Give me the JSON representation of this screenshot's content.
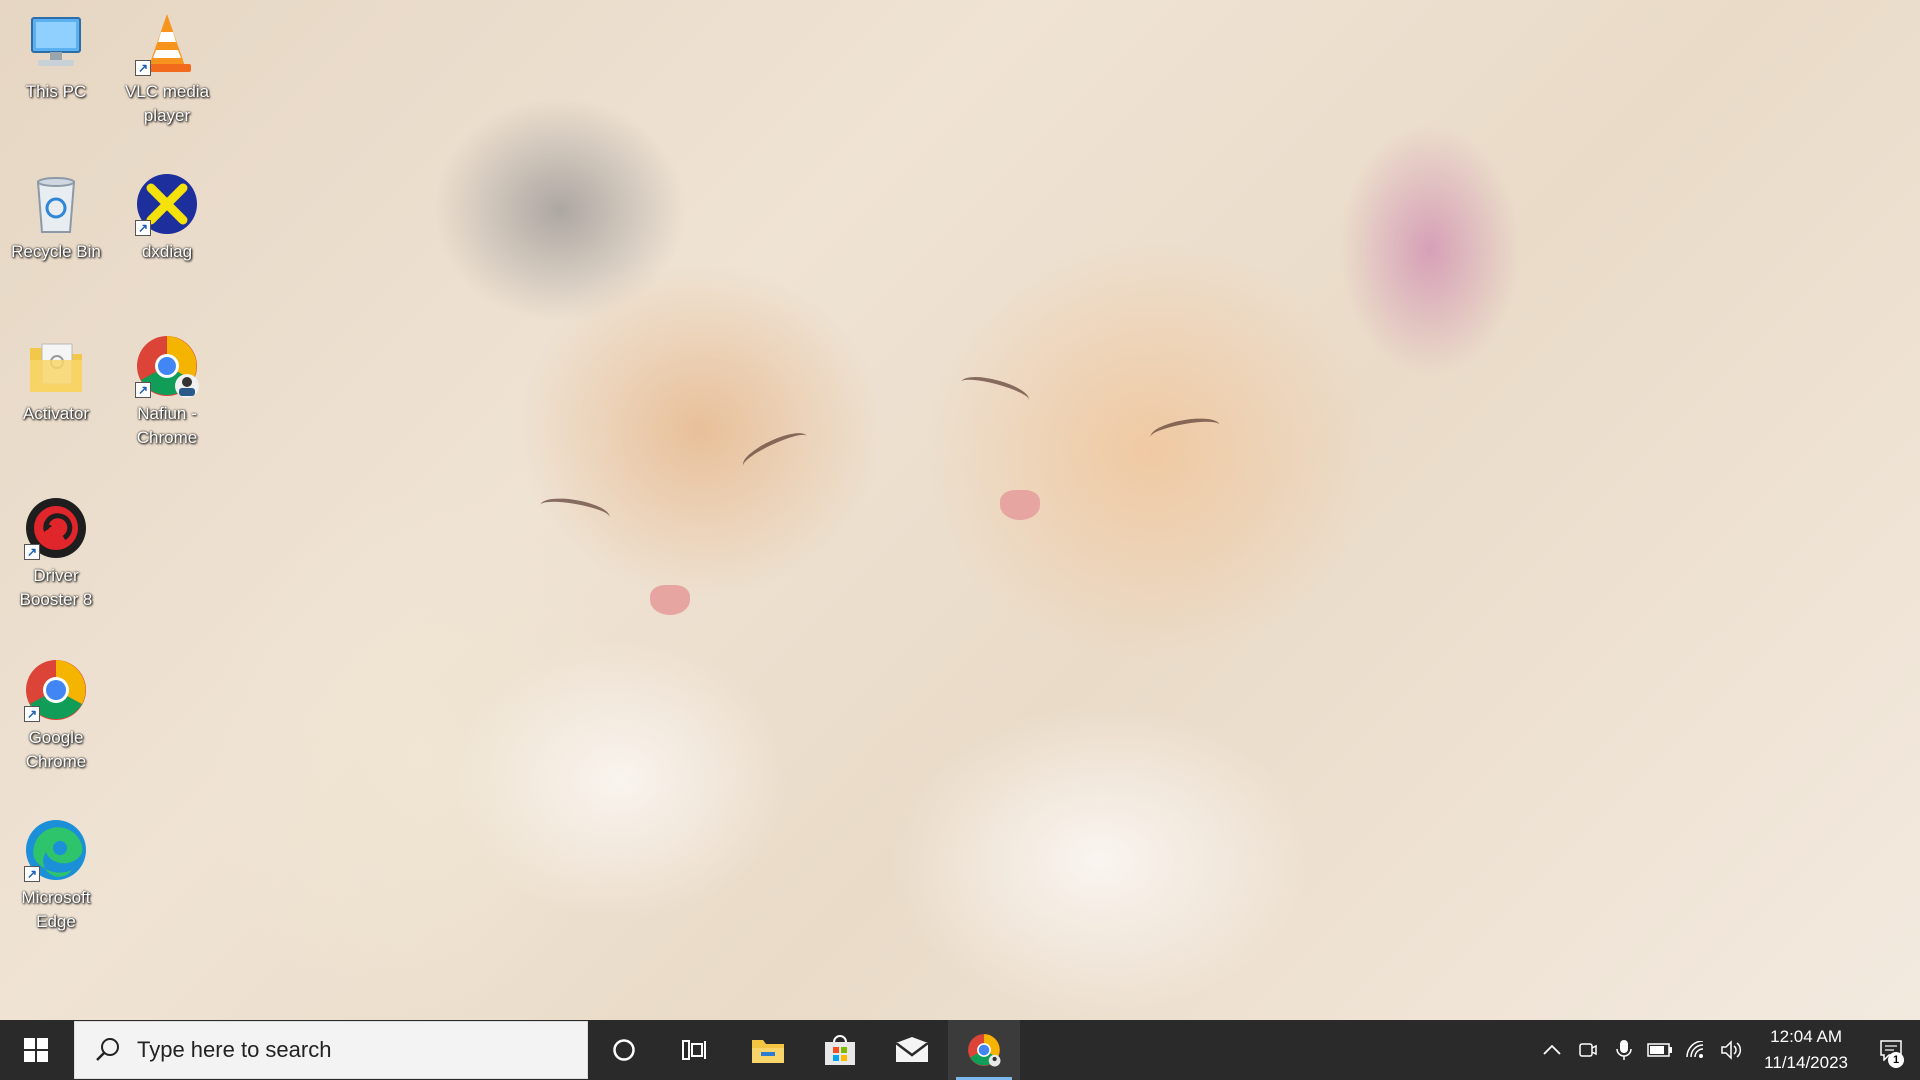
{
  "desktop": {
    "icons": [
      {
        "label": "This PC"
      },
      {
        "label": "VLC media player"
      },
      {
        "label": "Recycle Bin"
      },
      {
        "label": "dxdiag"
      },
      {
        "label": "Activator"
      },
      {
        "label": "Nafiun - Chrome"
      },
      {
        "label": "Driver Booster 8"
      },
      {
        "label": "Google Chrome"
      },
      {
        "label": "Microsoft Edge"
      }
    ]
  },
  "taskbar": {
    "search_placeholder": "Type here to search",
    "clock_time": "12:04 AM",
    "clock_date": "11/14/2023",
    "notification_count": "1",
    "apps": [
      {
        "icon": "cortana-icon"
      },
      {
        "icon": "task-view-icon"
      },
      {
        "icon": "file-explorer-icon"
      },
      {
        "icon": "microsoft-store-icon"
      },
      {
        "icon": "mail-icon"
      },
      {
        "icon": "chrome-icon",
        "active": true
      }
    ],
    "tray": [
      "show-hidden-icons",
      "meet-now-icon",
      "microphone-icon",
      "battery-icon",
      "wifi-icon",
      "volume-icon"
    ]
  },
  "colors": {
    "taskbar_bg": "#2a2a2a",
    "active_app_underline": "#7db8ef",
    "search_bg": "#f3f3f3"
  }
}
